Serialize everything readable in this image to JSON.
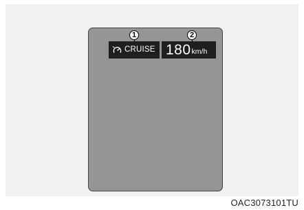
{
  "display": {
    "cruise": {
      "icon": "cruise-gauge-icon",
      "label": "CRUISE"
    },
    "speed": {
      "value": "180",
      "unit": "km/h"
    }
  },
  "callouts": [
    "1",
    "2"
  ],
  "figure_code": "OAC3073101TU",
  "colors": {
    "screen": "#959595",
    "segment": "#1f1f1f",
    "text": "#ffffff",
    "backdrop": "#f2f2f2"
  }
}
